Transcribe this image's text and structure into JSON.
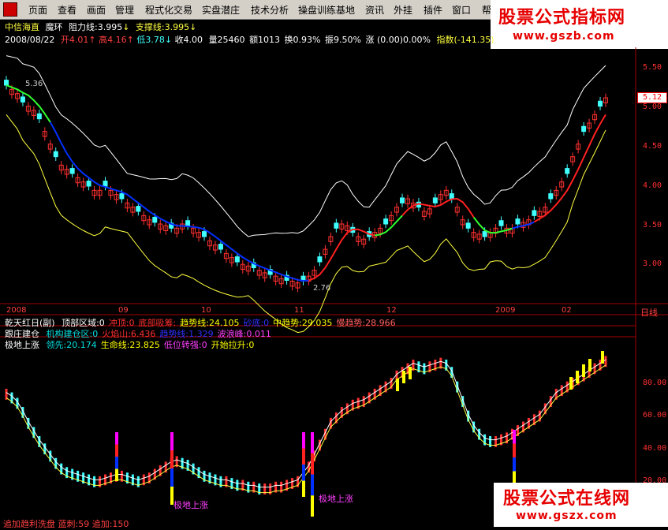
{
  "menu": [
    "页面",
    "查看",
    "画面",
    "管理",
    "程式化交易",
    "实盘潜庄",
    "技术分析",
    "操盘训练基地",
    "资讯",
    "外挂",
    "插件",
    "窗口",
    "帮"
  ],
  "watermark_top": {
    "line1": "股票公式指标网",
    "line2": "www.gszb.com"
  },
  "watermark_bottom": {
    "line1": "股票公式在线网",
    "line2": "www.gszx.com"
  },
  "header": {
    "stock": "中信海直",
    "indicator": "魔环",
    "resistance": "阻力线:3.995",
    "support": "支撑线:3.995",
    "date": "2008/08/22",
    "open": "开4.01",
    "high": "高4.16",
    "low": "低3.78",
    "close": "收4.00",
    "volume": "量25460",
    "amount": "额1013",
    "turnover": "换0.93%",
    "amplitude": "振9.50%",
    "change": "涨 (0.00)0.00%",
    "index": "指数(-141.35)"
  },
  "price_axis": [
    "5.50",
    "5.00",
    "4.50",
    "4.00",
    "3.50",
    "3.00"
  ],
  "current_price": "5.12",
  "annotations": {
    "high": "5.36",
    "low": "2.76"
  },
  "time_axis": [
    "2008",
    "09",
    "10",
    "11",
    "12",
    "2009",
    "02"
  ],
  "period": "日线",
  "panel1": {
    "title": "乾天红日(副)",
    "items": [
      {
        "label": "顶部区域:0",
        "color": "#ffffff"
      },
      {
        "label": "冲顶:0",
        "color": "#ff3030"
      },
      {
        "label": "底部吸筹:",
        "color": "#ff3030"
      },
      {
        "label": "趋势线:24.105",
        "color": "#ffff00"
      },
      {
        "label": "砂底:0",
        "color": "#3030ff"
      },
      {
        "label": "中趋势:29.035",
        "color": "#ffff00"
      },
      {
        "label": "慢趋势:28.966",
        "color": "#ff6060"
      }
    ]
  },
  "panel2": {
    "title": "跟庄建仓",
    "items": [
      {
        "label": "机构建仓区:0",
        "color": "#00e0e0"
      },
      {
        "label": "火焰山:6.436",
        "color": "#ff3030"
      },
      {
        "label": "趋势线:1.329",
        "color": "#3030ff"
      },
      {
        "label": "波浪峰:0.011",
        "color": "#ff40ff"
      }
    ]
  },
  "panel3": {
    "title": "极地上涨",
    "items": [
      {
        "label": "领先:20.174",
        "color": "#00e0e0"
      },
      {
        "label": "生命线:23.825",
        "color": "#ffff00"
      },
      {
        "label": "低位转强:0",
        "color": "#ff40ff"
      },
      {
        "label": "开始拉升:0",
        "color": "#ffff00"
      }
    ]
  },
  "osc_axis": [
    "80.00",
    "60.00",
    "40.00",
    "20.00"
  ],
  "osc_labels": [
    "极地上涨",
    "极地上涨"
  ],
  "bottom_text": "追加趋利洗盘  蓝刺:59  追加:150",
  "colors": {
    "up": "#ff3030",
    "down": "#40ffff",
    "ma_blue": "#0030ff",
    "ma_red": "#ff2020",
    "ma_green": "#30ff30",
    "band": "#ffffff",
    "band_low": "#ffff40",
    "axis": "#a00000"
  },
  "chart_data": {
    "type": "candlestick",
    "ylim": [
      2.7,
      5.7
    ],
    "prices": [
      5.25,
      5.2,
      5.15,
      5.05,
      5.0,
      4.95,
      4.85,
      4.7,
      4.55,
      4.4,
      4.3,
      4.25,
      4.2,
      4.15,
      4.1,
      4.05,
      4.0,
      4.0,
      4.05,
      4.0,
      3.95,
      3.9,
      3.85,
      3.8,
      3.75,
      3.7,
      3.65,
      3.62,
      3.6,
      3.58,
      3.55,
      3.55,
      3.6,
      3.58,
      3.55,
      3.5,
      3.45,
      3.4,
      3.35,
      3.3,
      3.25,
      3.2,
      3.15,
      3.12,
      3.1,
      3.08,
      3.05,
      3.02,
      3.0,
      2.98,
      2.95,
      2.93,
      2.92,
      2.9,
      2.92,
      2.98,
      3.05,
      3.15,
      3.3,
      3.45,
      3.55,
      3.6,
      3.58,
      3.5,
      3.45,
      3.42,
      3.45,
      3.5,
      3.55,
      3.6,
      3.7,
      3.8,
      3.85,
      3.9,
      3.85,
      3.8,
      3.75,
      3.78,
      3.85,
      3.95,
      4.0,
      3.9,
      3.8,
      3.65,
      3.55,
      3.5,
      3.48,
      3.45,
      3.5,
      3.55,
      3.58,
      3.55,
      3.55,
      3.6,
      3.62,
      3.65,
      3.7,
      3.75,
      3.8,
      3.9,
      4.0,
      4.1,
      4.2,
      4.4,
      4.55,
      4.7,
      4.8,
      4.9,
      5.0,
      5.1
    ],
    "oscillator": [
      68,
      66,
      63,
      58,
      52,
      47,
      42,
      38,
      34,
      30,
      27,
      25,
      24,
      23,
      22,
      21,
      20,
      20,
      21,
      22,
      23,
      23,
      22,
      21,
      20,
      21,
      22,
      24,
      26,
      28,
      30,
      31,
      30,
      29,
      27,
      25,
      23,
      22,
      21,
      20,
      20,
      19,
      18,
      18,
      17,
      17,
      16,
      16,
      16,
      17,
      17,
      18,
      19,
      20,
      24,
      28,
      34,
      40,
      46,
      52,
      55,
      58,
      60,
      62,
      63,
      64,
      66,
      68,
      70,
      72,
      74,
      78,
      80,
      82,
      84,
      83,
      82,
      83,
      84,
      85,
      84,
      80,
      72,
      64,
      56,
      50,
      46,
      43,
      42,
      42,
      43,
      44,
      46,
      48,
      50,
      52,
      54,
      56,
      60,
      64,
      68,
      70,
      72,
      74,
      76,
      78,
      80,
      82,
      84,
      86
    ]
  }
}
